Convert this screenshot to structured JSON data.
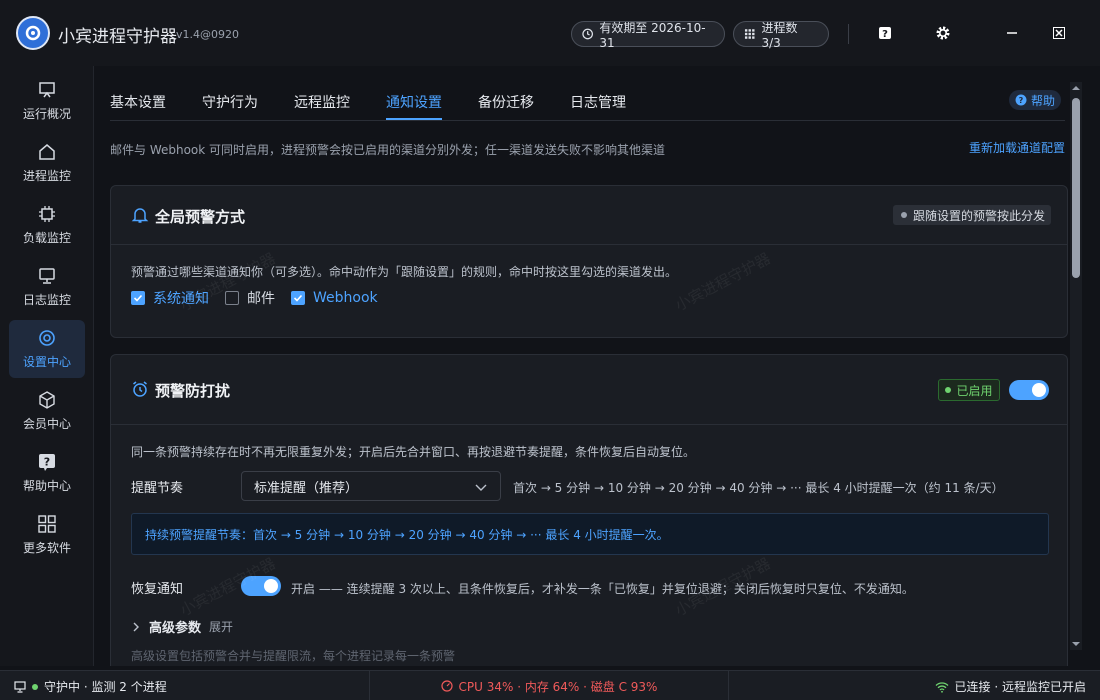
{
  "app": {
    "title": "小宾进程守护器",
    "version": "v1.4@0920"
  },
  "header": {
    "expire_label": "有效期至 2026-10-31",
    "process_label": "进程数 3/3",
    "icons": [
      "help-icon",
      "gear-icon",
      "minimize-icon",
      "close-icon"
    ]
  },
  "sidebar": {
    "items": [
      {
        "label": "运行概况",
        "icon": "monitor-stand-icon"
      },
      {
        "label": "进程监控",
        "icon": "home-icon"
      },
      {
        "label": "负载监控",
        "icon": "chip-icon"
      },
      {
        "label": "日志监控",
        "icon": "monitor-icon"
      },
      {
        "label": "设置中心",
        "icon": "target-settings-icon",
        "active": true
      },
      {
        "label": "会员中心",
        "icon": "box-icon"
      },
      {
        "label": "帮助中心",
        "icon": "question-icon"
      },
      {
        "label": "更多软件",
        "icon": "grid-icon"
      }
    ]
  },
  "tabs": [
    {
      "label": "基本设置"
    },
    {
      "label": "守护行为"
    },
    {
      "label": "远程监控"
    },
    {
      "label": "通知设置",
      "active": true
    },
    {
      "label": "备份迁移"
    },
    {
      "label": "日志管理"
    }
  ],
  "help_label": "帮助",
  "description": "邮件与 Webhook 可同时启用，进程预警会按已启用的渠道分别外发；任一渠道发送失败不影响其他渠道",
  "reload_link": "重新加载通道配置",
  "global_alert": {
    "title": "全局预警方式",
    "badge": "跟随设置的预警按此分发",
    "desc": "预警通过哪些渠道通知你（可多选）。命中动作为「跟随设置」的规则，命中时按这里勾选的渠道发出。",
    "channels": [
      {
        "label": "系统通知",
        "checked": true
      },
      {
        "label": "邮件",
        "checked": false
      },
      {
        "label": "Webhook",
        "checked": true
      }
    ]
  },
  "anti_disturb": {
    "title": "预警防打扰",
    "status": "已启用",
    "enabled": true,
    "desc": "同一条预警持续存在时不再无限重复外发；开启后先合并窗口、再按退避节奏提醒，条件恢复后自动复位。",
    "rhythm_label": "提醒节奏",
    "rhythm_value": "标准提醒（推荐）",
    "rhythm_text": "首次 → 5 分钟 → 10 分钟 → 20 分钟 → 40 分钟 → ··· 最长 4 小时提醒一次（约 11 条/天）",
    "info": "持续预警提醒节奏：首次 → 5 分钟 → 10 分钟 → 20 分钟 → 40 分钟 → ··· 最长 4 小时提醒一次。",
    "restore_label": "恢复通知",
    "restore_enabled": true,
    "restore_text": "开启 —— 连续提醒 3 次以上、且条件恢复后，才补发一条「已恢复」并复位退避；关闭后恢复时只复位、不发通知。",
    "advanced_title": "高级参数",
    "advanced_expand": "展开",
    "advanced_hint": "高级设置包括预警合并与提醒限流，每个进程记录每一条预警"
  },
  "watermark": "小宾进程守护器",
  "status": {
    "left": "守护中 · 监测 2 个进程",
    "center": "CPU 34% · 内存 64% · 磁盘 C 93%",
    "right": "已连接 · 远程监控已开启"
  },
  "colors": {
    "accent": "#4da3ff",
    "ok": "#6fd36f",
    "warn": "#f05a5a",
    "bg": "#111318",
    "card": "#1a1d23"
  }
}
